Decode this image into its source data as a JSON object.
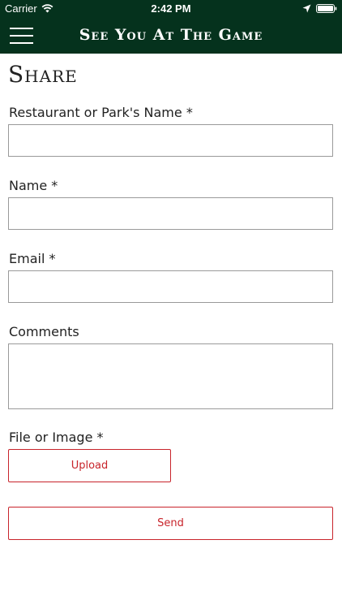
{
  "status_bar": {
    "carrier": "Carrier",
    "time": "2:42 PM"
  },
  "nav": {
    "title": "See You At The Game",
    "menu_icon": "hamburger-menu-icon"
  },
  "page": {
    "title": "Share"
  },
  "form": {
    "restaurant_label": "Restaurant or Park's Name *",
    "restaurant_value": "",
    "name_label": "Name *",
    "name_value": "",
    "email_label": "Email *",
    "email_value": "",
    "comments_label": "Comments",
    "comments_value": "",
    "file_label": "File or Image *",
    "upload_label": "Upload",
    "send_label": "Send"
  },
  "colors": {
    "header_background": "#05321d",
    "accent": "#c8242b",
    "input_border": "#9a9a9a",
    "text": "#222222"
  }
}
